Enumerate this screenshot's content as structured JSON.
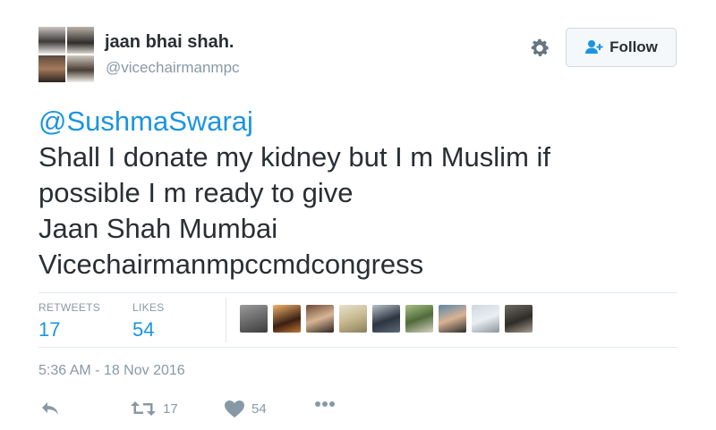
{
  "user": {
    "display_name": "jaan bhai shah.",
    "handle": "@vicechairmanmpc"
  },
  "header": {
    "follow_label": "Follow",
    "gear_icon": "gear-icon",
    "follow_icon": "follow-user-icon"
  },
  "tweet": {
    "mention": "@SushmaSwaraj",
    "lines": [
      "Shall I donate my kidney but I m Muslim if",
      "possible I m ready to give",
      "Jaan Shah Mumbai",
      "Vicechairmanmpccmdcongress"
    ]
  },
  "stats": {
    "retweets_label": "RETWEETS",
    "retweets_value": "17",
    "likes_label": "LIKES",
    "likes_value": "54"
  },
  "timestamp": "5:36 AM - 18 Nov 2016",
  "actions": {
    "reply_icon": "reply-icon",
    "retweet_icon": "retweet-icon",
    "retweet_count": "17",
    "like_icon": "heart-icon",
    "like_count": "54",
    "more_icon": "more-icon"
  },
  "colors": {
    "link": "#1b95e0",
    "muted": "#8899a6",
    "text": "#292f33"
  }
}
